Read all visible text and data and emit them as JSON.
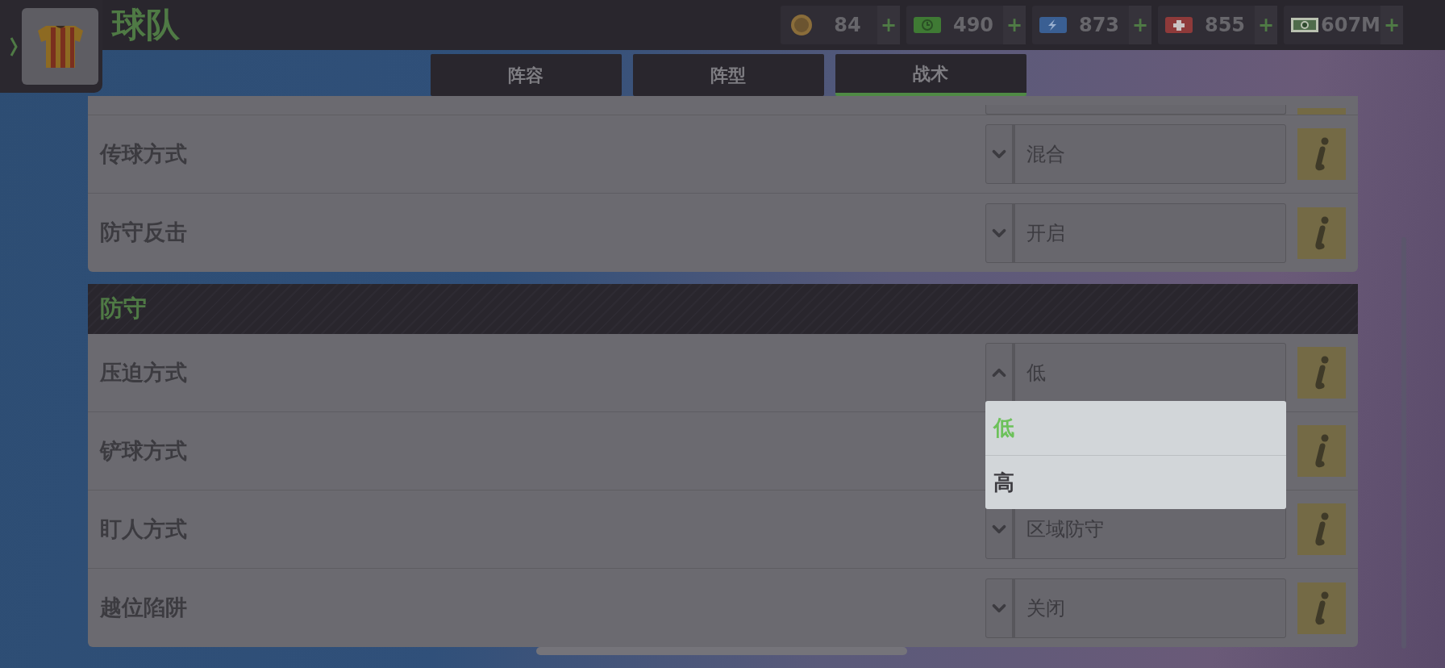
{
  "header": {
    "title": "球队",
    "currencies": [
      {
        "kind": "coin",
        "amount": "84",
        "add": "+"
      },
      {
        "kind": "clock",
        "amount": "490",
        "add": "+"
      },
      {
        "kind": "energy",
        "amount": "873",
        "add": "+"
      },
      {
        "kind": "health",
        "amount": "855",
        "add": "+"
      },
      {
        "kind": "cash",
        "amount": "607M",
        "add": "+"
      }
    ]
  },
  "tabs": [
    {
      "label": "阵容",
      "selected": false
    },
    {
      "label": "阵型",
      "selected": false
    },
    {
      "label": "战术",
      "selected": true
    }
  ],
  "upper_panel": {
    "rows": [
      {
        "label": "传球方式",
        "value": "混合",
        "expanded": false
      },
      {
        "label": "防守反击",
        "value": "开启",
        "expanded": false
      }
    ]
  },
  "defense_section": {
    "title": "防守",
    "rows": [
      {
        "label": "压迫方式",
        "value": "低",
        "expanded": true,
        "options": [
          {
            "label": "低",
            "selected": true
          },
          {
            "label": "高",
            "selected": false
          }
        ]
      },
      {
        "label": "铲球方式"
      },
      {
        "label": "盯人方式",
        "value": "区域防守",
        "expanded": false
      },
      {
        "label": "越位陷阱",
        "value": "关闭",
        "expanded": false
      }
    ]
  }
}
